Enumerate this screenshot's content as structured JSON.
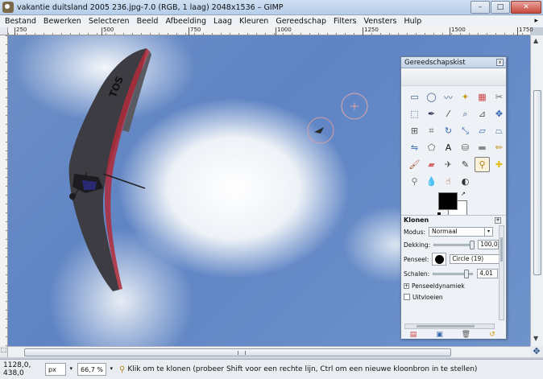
{
  "window": {
    "title": "vakantie duitsland 2005 236.jpg-7.0 (RGB, 1 laag) 2048x1536 – GIMP",
    "minimize": "–",
    "maximize": "□",
    "close": "✕"
  },
  "menu": {
    "items": [
      "Bestand",
      "Bewerken",
      "Selecteren",
      "Beeld",
      "Afbeelding",
      "Laag",
      "Kleuren",
      "Gereedschap",
      "Filters",
      "Vensters",
      "Hulp"
    ],
    "overflow_arrow": "▸"
  },
  "ruler": {
    "ticks": [
      "250",
      "500",
      "750",
      "1000",
      "1250",
      "1500",
      "1750"
    ]
  },
  "image": {
    "glider_text": "TOS"
  },
  "scroll": {
    "up": "▲",
    "down": "▼",
    "navigate": "✥"
  },
  "status": {
    "coordinates": "1128,0, 438,0",
    "unit": "px",
    "zoom": "66,7 %",
    "message": "Klik om te klonen (probeer Shift voor een rechte lijn, Ctrl om een nieuwe kloonbron in te stellen)",
    "dropdown_arrow": "▾"
  },
  "toolbox": {
    "title": "Gereedschapskist",
    "close_glyph": "x",
    "tools": [
      {
        "name": "rect-select-icon",
        "glyph": "▭",
        "color": "#3a5a8a"
      },
      {
        "name": "ellipse-select-icon",
        "glyph": "◯",
        "color": "#3a5a8a"
      },
      {
        "name": "free-select-icon",
        "glyph": "〰",
        "color": "#3a5a8a"
      },
      {
        "name": "fuzzy-select-icon",
        "glyph": "✦",
        "color": "#c89a20"
      },
      {
        "name": "color-select-icon",
        "glyph": "▦",
        "color": "#c44"
      },
      {
        "name": "scissors-select-icon",
        "glyph": "✂",
        "color": "#666"
      },
      {
        "name": "foreground-select-icon",
        "glyph": "⬚",
        "color": "#3a5a8a"
      },
      {
        "name": "paths-icon",
        "glyph": "✒",
        "color": "#335"
      },
      {
        "name": "color-picker-icon",
        "glyph": "⁄",
        "color": "#333"
      },
      {
        "name": "zoom-icon",
        "glyph": "⌕",
        "color": "#3a5a8a"
      },
      {
        "name": "measure-icon",
        "glyph": "⊿",
        "color": "#555"
      },
      {
        "name": "move-icon",
        "glyph": "✥",
        "color": "#2a5fb0"
      },
      {
        "name": "align-icon",
        "glyph": "⊞",
        "color": "#555"
      },
      {
        "name": "crop-icon",
        "glyph": "⌗",
        "color": "#555"
      },
      {
        "name": "rotate-icon",
        "glyph": "↻",
        "color": "#3a6ab0"
      },
      {
        "name": "scale-icon",
        "glyph": "⤡",
        "color": "#3a6ab0"
      },
      {
        "name": "shear-icon",
        "glyph": "▱",
        "color": "#3a6ab0"
      },
      {
        "name": "perspective-icon",
        "glyph": "⏢",
        "color": "#3a6ab0"
      },
      {
        "name": "flip-icon",
        "glyph": "⇋",
        "color": "#3a6ab0"
      },
      {
        "name": "cage-icon",
        "glyph": "⬠",
        "color": "#555"
      },
      {
        "name": "text-icon",
        "glyph": "A",
        "color": "#111"
      },
      {
        "name": "bucket-fill-icon",
        "glyph": "⛁",
        "color": "#555"
      },
      {
        "name": "blend-icon",
        "glyph": "▬",
        "color": "#888"
      },
      {
        "name": "pencil-icon",
        "glyph": "✏",
        "color": "#c8901a"
      },
      {
        "name": "paintbrush-icon",
        "glyph": "🖌",
        "color": "#a0522d"
      },
      {
        "name": "eraser-icon",
        "glyph": "▰",
        "color": "#d46a6a"
      },
      {
        "name": "airbrush-icon",
        "glyph": "✈",
        "color": "#555"
      },
      {
        "name": "ink-icon",
        "glyph": "✎",
        "color": "#333"
      },
      {
        "name": "clone-icon",
        "glyph": "⚲",
        "color": "#b07a20"
      },
      {
        "name": "heal-icon",
        "glyph": "✚",
        "color": "#e0c020"
      },
      {
        "name": "perspective-clone-icon",
        "glyph": "⚲",
        "color": "#777"
      },
      {
        "name": "blur-icon",
        "glyph": "💧",
        "color": "#3a6ab0"
      },
      {
        "name": "smudge-icon",
        "glyph": "☝",
        "color": "#a0522d"
      },
      {
        "name": "dodge-burn-icon",
        "glyph": "◐",
        "color": "#333"
      }
    ],
    "options": {
      "title": "Klonen",
      "mode_label": "Modus:",
      "mode_value": "Normaal",
      "opacity_label": "Dekking:",
      "opacity_value": "100,0",
      "opacity_fraction": 1.0,
      "brush_label": "Penseel:",
      "brush_name": "Circle (19)",
      "scale_label": "Schalen:",
      "scale_value": "4,01",
      "dynamics_label": "Penseeldynamiek",
      "fade_label": "Uitvloeien",
      "expand_glyph": "+",
      "spin_up": "▲",
      "spin_down": "▼"
    },
    "footer_buttons": [
      {
        "name": "save-options-icon",
        "glyph": "▤",
        "color": "#c44"
      },
      {
        "name": "restore-options-icon",
        "glyph": "▣",
        "color": "#3a6ab0"
      },
      {
        "name": "delete-options-icon",
        "glyph": "🗑",
        "color": "#555"
      },
      {
        "name": "reset-options-icon",
        "glyph": "↺",
        "color": "#d09a10"
      }
    ]
  }
}
